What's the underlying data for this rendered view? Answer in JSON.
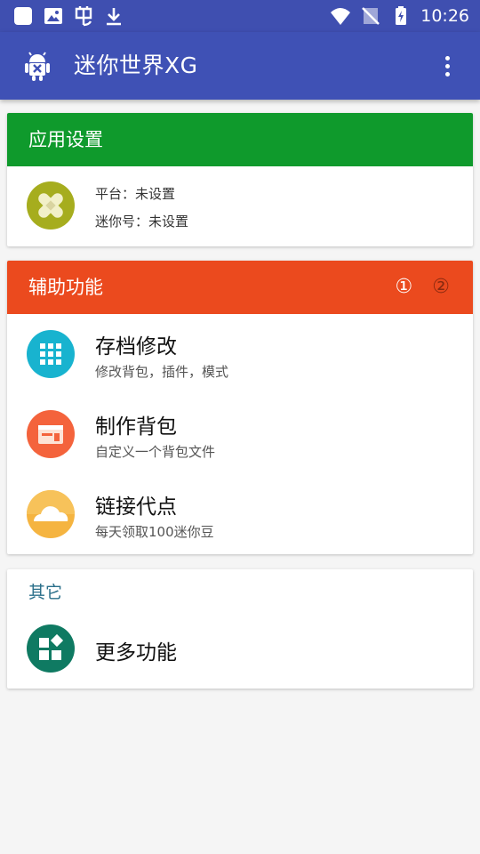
{
  "status_bar": {
    "time": "10:26",
    "left_icons": [
      "app-square-icon",
      "image-icon",
      "bug-icon",
      "download-icon"
    ],
    "right_icons": [
      "wifi-icon",
      "no-signal-icon",
      "battery-charging-icon"
    ]
  },
  "app_bar": {
    "title": "迷你世界XG",
    "logo_icon": "android-robot-icon",
    "menu_icon": "more-vert-icon"
  },
  "settings_card": {
    "header": "应用设置",
    "header_color": "#0f9a2c",
    "platform_label": "平台：未设置",
    "mini_id_label": "迷你号：未设置"
  },
  "assist_card": {
    "header": "辅助功能",
    "header_color": "#eb4a1e",
    "steps": [
      "①",
      "②"
    ],
    "items": [
      {
        "title": "存档修改",
        "subtitle": "修改背包，插件，模式",
        "icon": "grid-apps-icon",
        "color": "#18b3cf"
      },
      {
        "title": "制作背包",
        "subtitle": "自定义一个背包文件",
        "icon": "window-icon",
        "color": "#f4633c"
      },
      {
        "title": "链接代点",
        "subtitle": "每天领取100迷你豆",
        "icon": "cloud-icon",
        "color": "#f5b440"
      }
    ]
  },
  "other_card": {
    "label": "其它",
    "items": [
      {
        "title": "更多功能",
        "icon": "widgets-icon",
        "color": "#0f7a62"
      }
    ]
  }
}
